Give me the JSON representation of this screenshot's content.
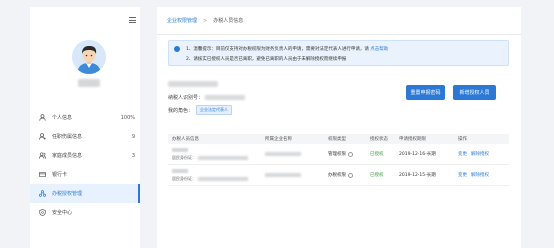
{
  "sidebar": {
    "items": [
      {
        "label": "个人信息",
        "count": "100%",
        "icon": "user-icon"
      },
      {
        "label": "任职伤属信息",
        "count": "9",
        "icon": "person-badge-icon"
      },
      {
        "label": "家庭成员信息",
        "count": "3",
        "icon": "family-icon"
      },
      {
        "label": "银行卡",
        "count": "",
        "icon": "bank-card-icon"
      },
      {
        "label": "办税授权管理",
        "count": "",
        "icon": "authorization-icon"
      },
      {
        "label": "安全中心",
        "count": "",
        "icon": "shield-icon"
      }
    ]
  },
  "breadcrumb": {
    "parent": "企业权限管理",
    "separator": ">",
    "current": "办税人员信息"
  },
  "notice": {
    "line1_text": "1、温馨提示：目前仅支持对办税权限为财务负责人的申请，需要对法定代表人进行申请，请",
    "line1_link": "点击帮助",
    "line2_text": "2、请核实已授权人员是否已离职，避免已离职的人员由于未解除授权而继续申报"
  },
  "company": {
    "taxid_label": "纳税人识别号：",
    "role_label": "我的角色：",
    "role_tag": "企业法定代表人"
  },
  "buttons": {
    "reset": "重置申报密码",
    "add": "新增授权人员"
  },
  "table": {
    "headers": [
      "办税人员信息",
      "所属企业名称",
      "权限类型",
      "授权状态",
      "申请授权期限",
      "操作"
    ],
    "id_label": "居民身份证：",
    "rows": [
      {
        "perm": "管理权限",
        "status": "已授权",
        "period": "2019-12-16-长期",
        "ops": [
          "变更",
          "解除授权"
        ]
      },
      {
        "perm": "办税权限",
        "status": "已授权",
        "period": "2019-12-15-长期",
        "ops": [
          "变更",
          "解除授权"
        ]
      }
    ]
  },
  "colors": {
    "accent": "#2b79d4",
    "active_bg": "#e8f2ff",
    "ok": "#3aa046"
  }
}
